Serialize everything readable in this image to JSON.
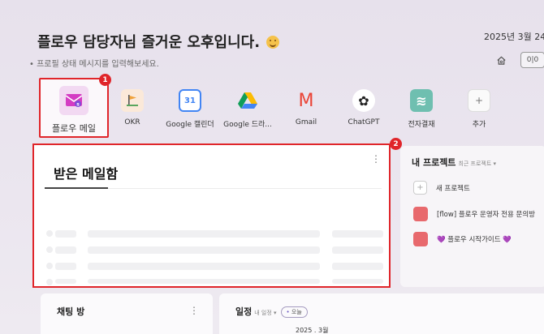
{
  "header": {
    "greeting": "플로우 담당자님 즐거운 오후입니다.",
    "status_prompt": "• 프로필 상태 메시지를 입력해보세요.",
    "date": "2025년 3월 24",
    "home_icon": "home-icon",
    "layout_icon": "layout-grid-icon",
    "layout_label": "0|0"
  },
  "apps": [
    {
      "label": "플로우 메일",
      "icon": "mail-icon"
    },
    {
      "label": "OKR",
      "icon": "flag-icon"
    },
    {
      "label": "Google 캘린더",
      "icon": "calendar-icon",
      "glyph": "31"
    },
    {
      "label": "Google 드라...",
      "icon": "drive-icon"
    },
    {
      "label": "Gmail",
      "icon": "gmail-icon",
      "glyph": "M"
    },
    {
      "label": "ChatGPT",
      "icon": "chatgpt-icon",
      "glyph": "✿"
    },
    {
      "label": "전자결재",
      "icon": "approval-icon",
      "glyph": "≋"
    },
    {
      "label": "추가",
      "icon": "plus-icon",
      "glyph": "+"
    }
  ],
  "annotations": {
    "badge1": "1",
    "badge2": "2"
  },
  "mail_widget": {
    "title": "받은 메일함",
    "menu_glyph": "⋮"
  },
  "projects": {
    "title": "내 프로젝트",
    "subtitle": "최근 프로젝트 ▾",
    "new_project": "새 프로젝트",
    "new_glyph": "+",
    "items": [
      {
        "name": "[flow] 플로우 운영자 전용 문의방",
        "color": "#e8696d"
      },
      {
        "name": "💜 플로우 시작가이드 💜",
        "color": "#e8696d"
      }
    ]
  },
  "chat_widget": {
    "title": "채팅 방",
    "menu_glyph": "⋮"
  },
  "schedule_widget": {
    "title": "일정",
    "subtitle": "내 일정 ▾",
    "today": "오늘",
    "date_stub": "2025 . 3월"
  },
  "colors": {
    "accent_red": "#e0252a",
    "project_red": "#e8696d",
    "background": "#e9e4ee"
  }
}
